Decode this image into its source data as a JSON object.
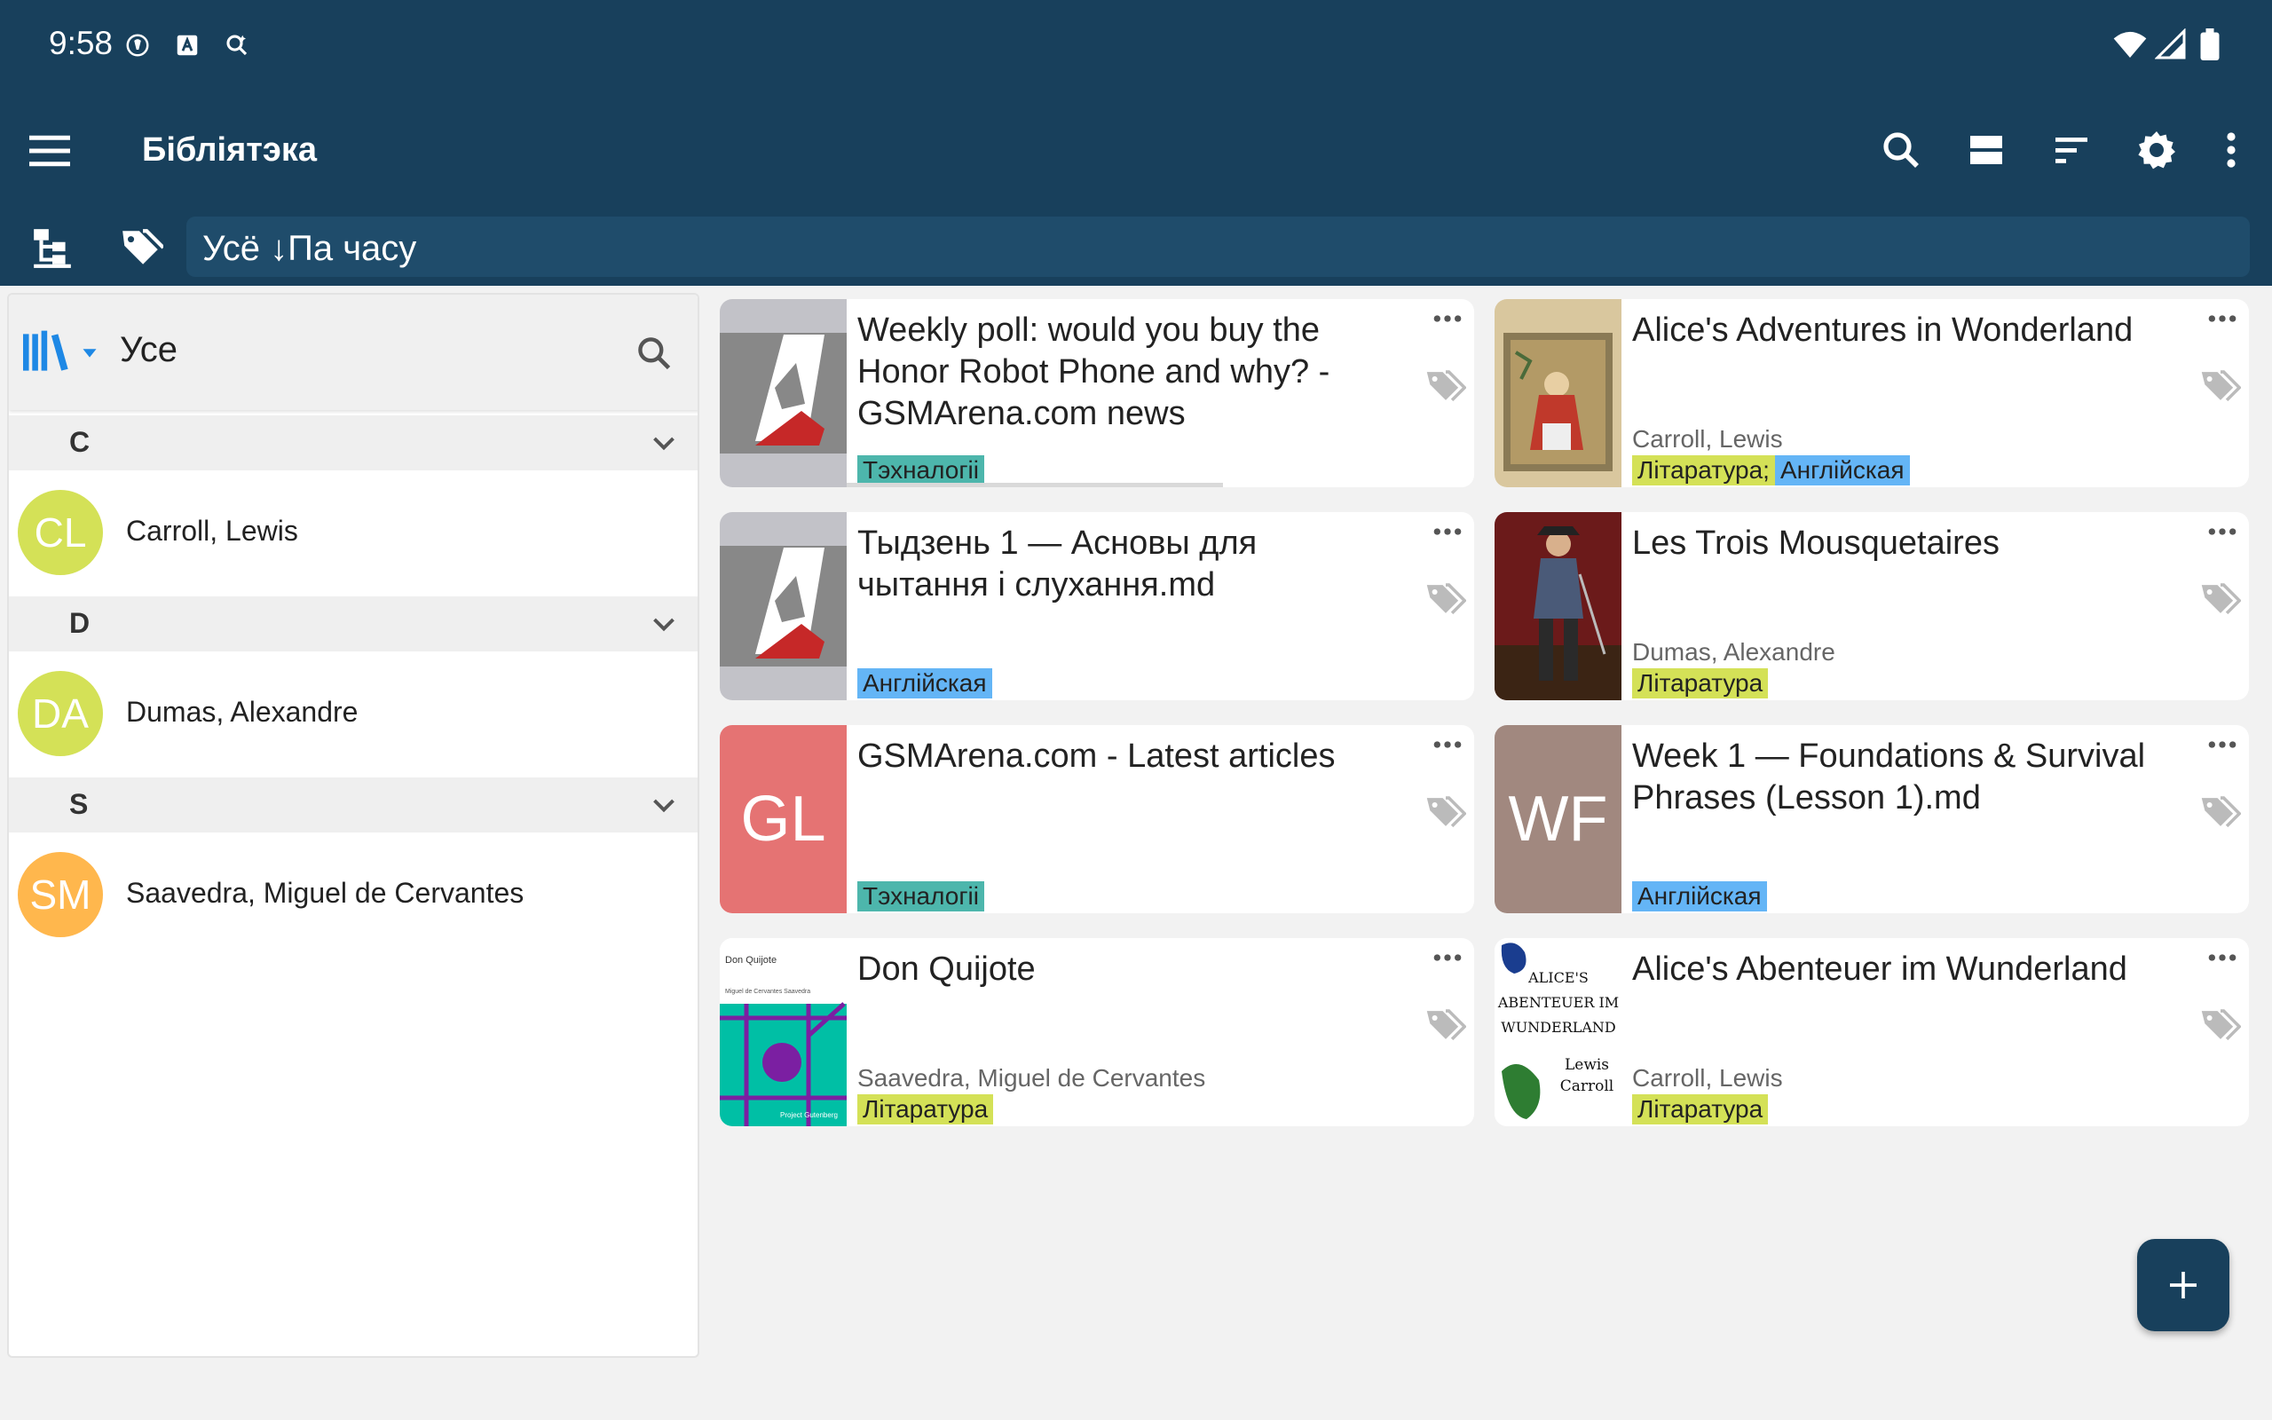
{
  "status_bar": {
    "time": "9:58"
  },
  "app_bar": {
    "title": "Бібліятэка",
    "actions": [
      "search-icon",
      "view-list-icon",
      "sort-icon",
      "settings-icon",
      "overflow-menu-icon"
    ]
  },
  "filter_bar": {
    "query": "Усё ↓Па часу"
  },
  "left_panel": {
    "library_title": "Усе",
    "sections": [
      {
        "letter": "C",
        "people": [
          {
            "initials": "CL",
            "name": "Carroll, Lewis",
            "color": "#d4e157"
          }
        ]
      },
      {
        "letter": "D",
        "people": [
          {
            "initials": "DA",
            "name": "Dumas, Alexandre",
            "color": "#d4e157"
          }
        ]
      },
      {
        "letter": "S",
        "people": [
          {
            "initials": "SM",
            "name": "Saavedra, Miguel de Cervantes",
            "color": "#ffb74d"
          }
        ]
      }
    ]
  },
  "cards": [
    {
      "title": "Weekly poll: would you buy the Honor Robot Phone and why? - GSMArena.com news",
      "author": "",
      "tags": [
        {
          "label": "Тэхналогіі",
          "color": "#4db6ac"
        }
      ],
      "thumb": "gsmarena-logo",
      "progress": 0.6
    },
    {
      "title": "Alice's Adventures in Wonderland",
      "author": "Carroll, Lewis",
      "tags": [
        {
          "label": "Літаратура;",
          "color": "#d4e157"
        },
        {
          "label": "Англійская",
          "color": "#64b5f6"
        }
      ],
      "thumb": "alice-cover"
    },
    {
      "title": "Тыдзень 1 — Асновы для чытання і слухання.md",
      "author": "",
      "tags": [
        {
          "label": "Англійская",
          "color": "#64b5f6"
        }
      ],
      "thumb": "gsmarena-logo"
    },
    {
      "title": "Les Trois Mousquetaires",
      "author": "Dumas, Alexandre",
      "tags": [
        {
          "label": "Літаратура",
          "color": "#d4e157"
        }
      ],
      "thumb": "musketeer-painting"
    },
    {
      "title": "GSMArena.com - Latest articles",
      "author": "",
      "tags": [
        {
          "label": "Тэхналогіі",
          "color": "#4db6ac"
        }
      ],
      "thumb_initials": "GL",
      "thumb_color": "#e57373"
    },
    {
      "title": "Week 1 — Foundations & Survival Phrases (Lesson 1).md",
      "author": "",
      "tags": [
        {
          "label": "Англійская",
          "color": "#64b5f6"
        }
      ],
      "thumb_initials": "WF",
      "thumb_color": "#a1887f"
    },
    {
      "title": "Don Quijote",
      "author": "Saavedra, Miguel de Cervantes",
      "tags": [
        {
          "label": "Літаратура",
          "color": "#d4e157"
        }
      ],
      "thumb": "don-quijote-cover",
      "cover_title": "Don Quijote",
      "cover_author": "Miguel de Cervantes Saavedra",
      "cover_publisher": "Project Gutenberg"
    },
    {
      "title": "Alice's Abenteuer im Wunderland",
      "author": "Carroll, Lewis",
      "tags": [
        {
          "label": "Літаратура",
          "color": "#d4e157"
        }
      ],
      "thumb": "alice-abenteuer-cover",
      "cover_lines": [
        "ALICE'S",
        "ABENTEUER IM",
        "WUNDERLAND",
        "Lewis",
        "Carroll"
      ]
    }
  ],
  "colors": {
    "primary": "#18405c",
    "field": "#1f4c6b",
    "accent_icon": "#1e88e5"
  }
}
